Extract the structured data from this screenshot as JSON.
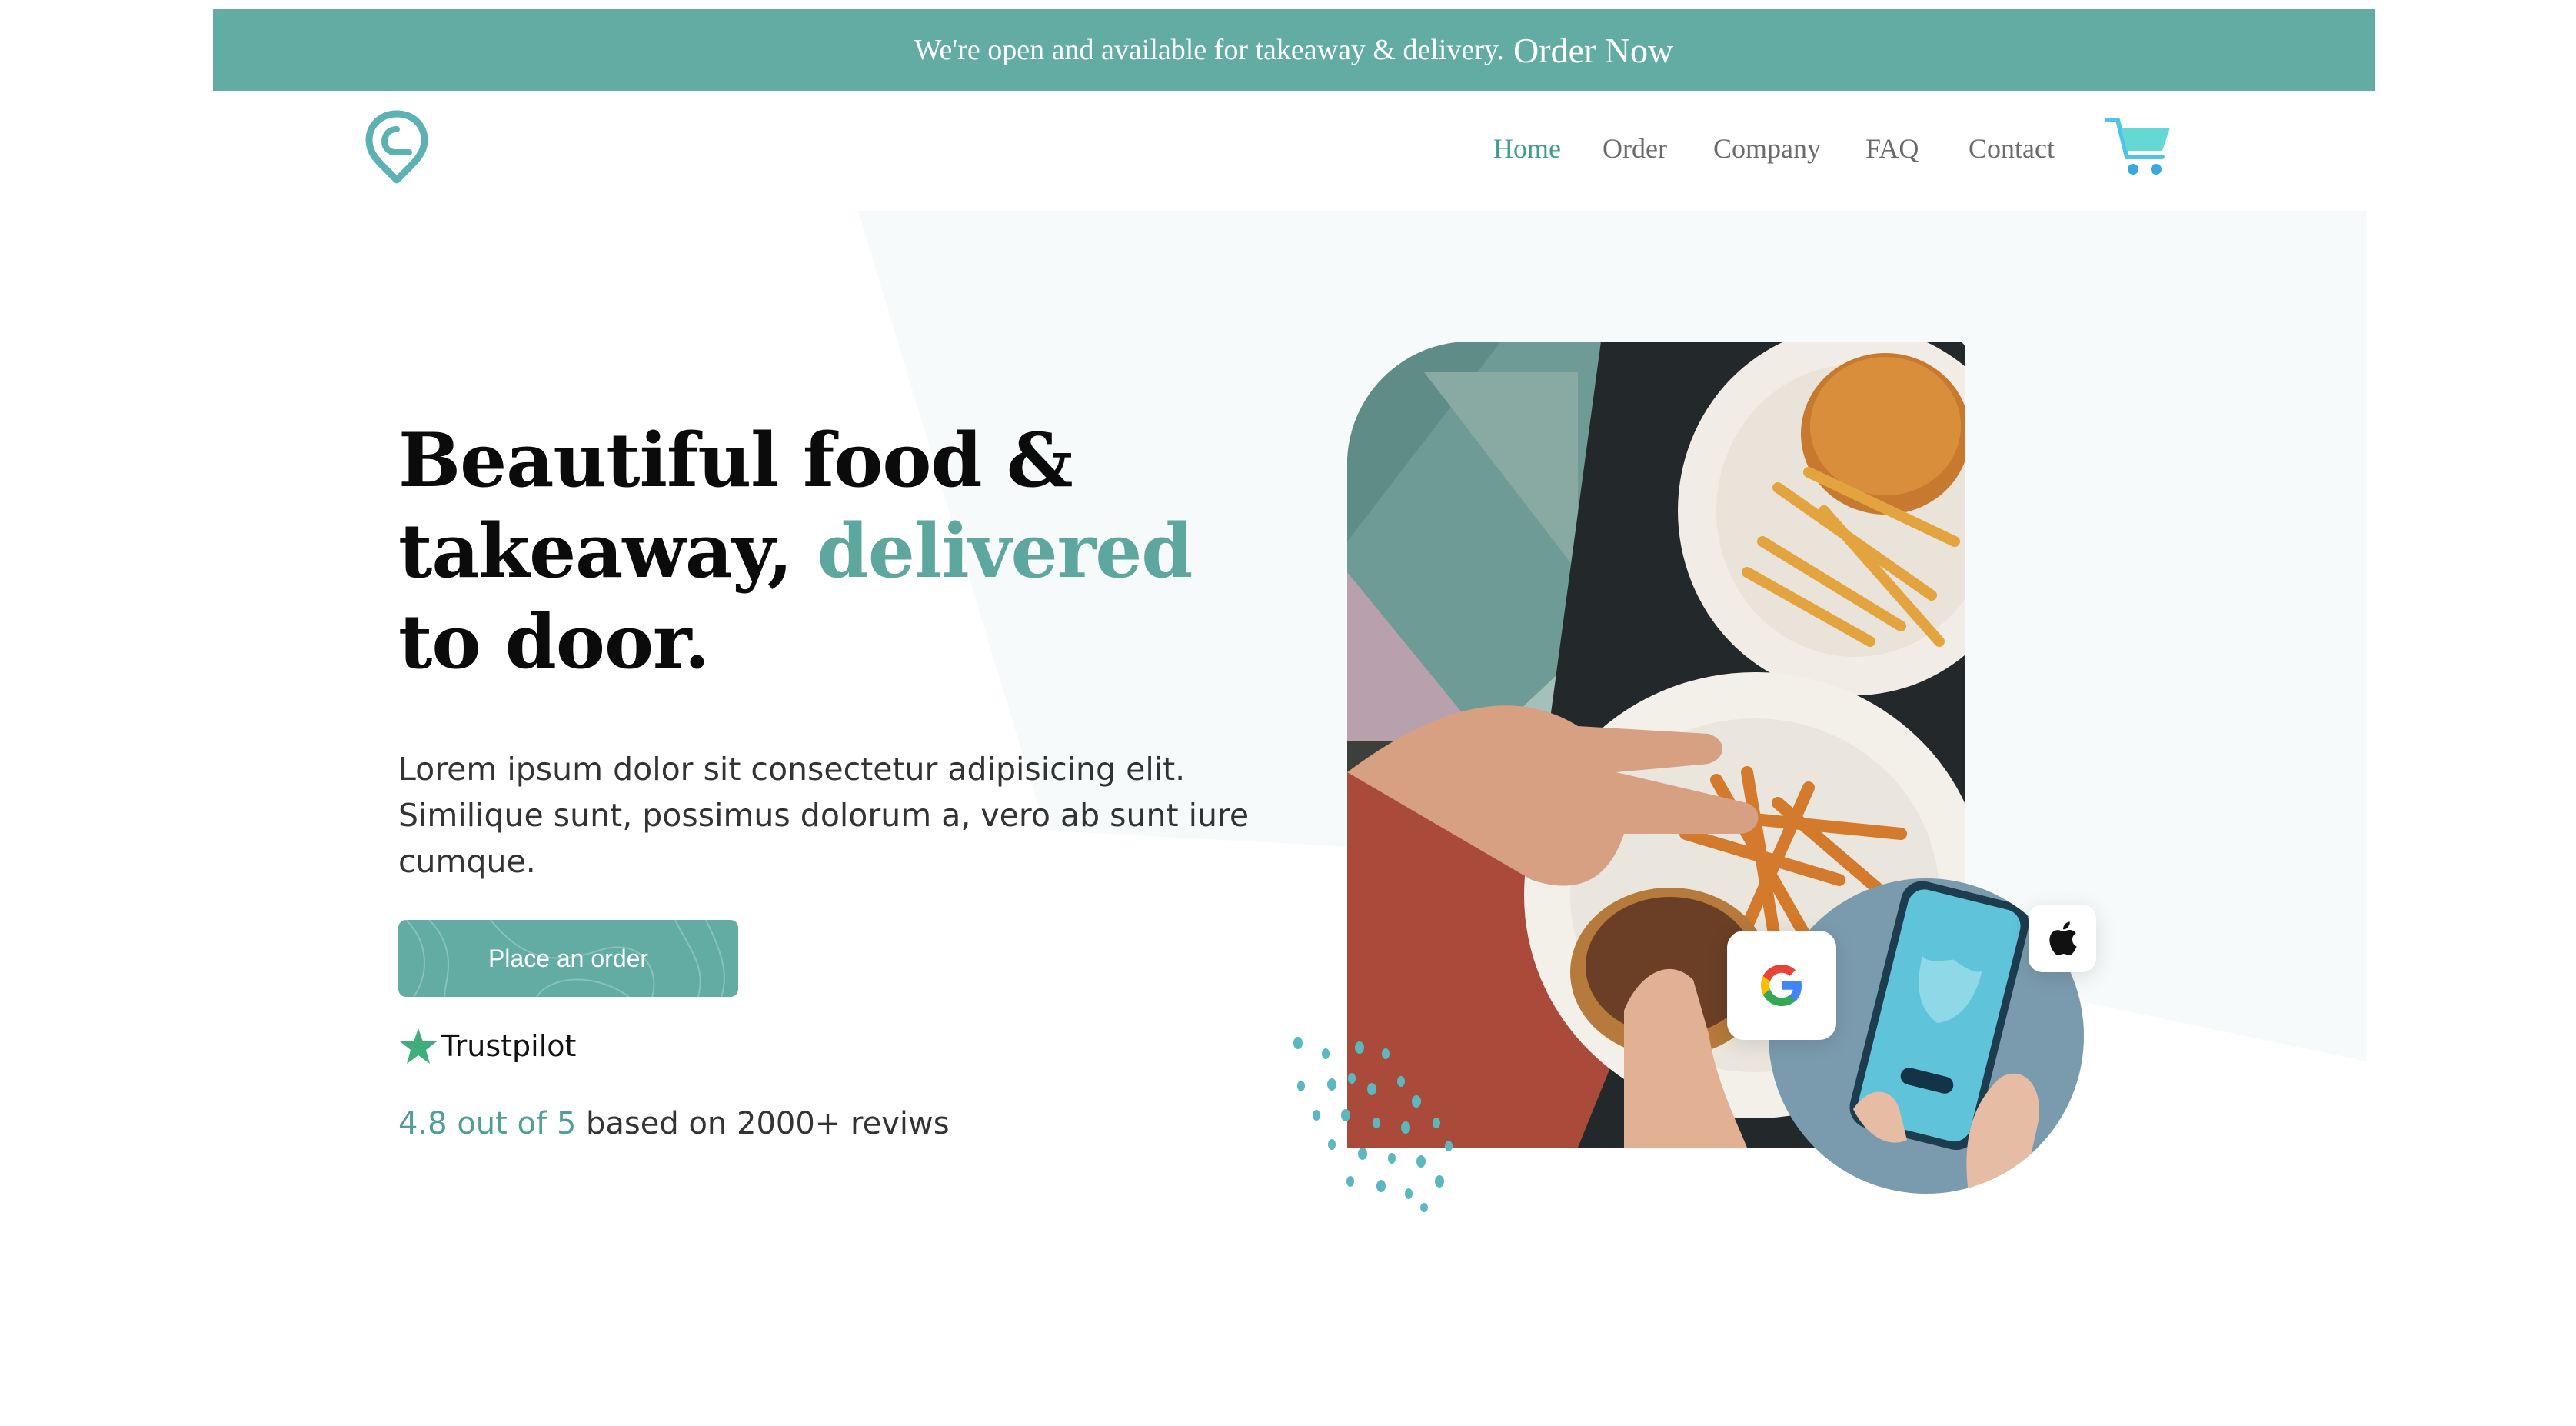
{
  "banner": {
    "message": "We're open and available for takeaway & delivery.",
    "cta": "Order Now"
  },
  "nav": {
    "items": [
      {
        "label": "Home",
        "active": true
      },
      {
        "label": "Order",
        "active": false
      },
      {
        "label": "Company",
        "active": false
      },
      {
        "label": "FAQ",
        "active": false
      },
      {
        "label": "Contact",
        "active": false
      }
    ]
  },
  "hero": {
    "headline_line1": "Beautiful food &",
    "headline_line2a": "takeaway,",
    "headline_line2b": "delivered",
    "headline_line3": "to door.",
    "description": "Lorem ipsum dolor sit consectetur adipisicing elit. Similique sunt, possimus dolorum a, vero ab sunt iure cumque.",
    "button": "Place an order"
  },
  "trust": {
    "brand": "Trustpilot",
    "score": "4.8 out of 5",
    "reviews": "based on 2000+ reviws"
  },
  "colors": {
    "accent": "#62aca4",
    "accent_text": "#5ea79f",
    "cart": "#4fc3e8"
  },
  "icons": [
    "location-pin-logo-icon",
    "cart-icon",
    "star-icon",
    "google-icon",
    "apple-icon"
  ]
}
